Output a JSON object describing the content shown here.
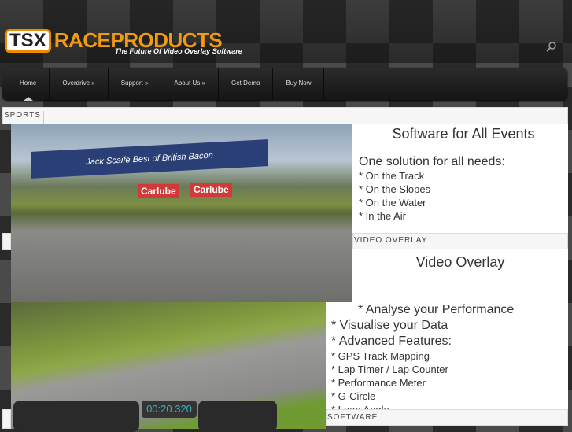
{
  "header": {
    "logo_tsx": "TSX",
    "logo_name": "RACEPRODUCTS",
    "tagline": "The Future Of Video Overlay Software"
  },
  "nav": [
    "Home",
    "Overdrive »",
    "Support »",
    "About Us »",
    "Get Demo",
    "Buy Now"
  ],
  "sections": {
    "sports": "SPORTS",
    "video_overlay": "VIDEO OVERLAY",
    "software": "SOFTWARE"
  },
  "panel1": {
    "title": "Software for All Events",
    "subtitle": "One solution for all needs:",
    "items": [
      "* On the Track",
      "* On the Slopes",
      "* On the Water",
      "* In the Air"
    ]
  },
  "panel2": {
    "title": "Video Overlay",
    "main_items": [
      "* Analyse your Performance",
      "* Visualise your Data",
      "* Advanced Features:"
    ],
    "items": [
      "* GPS Track Mapping",
      "* Lap Timer / Lap Counter",
      "* Performance Meter",
      "* G-Circle",
      "* Lean Angle"
    ]
  },
  "photo1": {
    "banner": "Jack Scaife Best of British Bacon",
    "sign1": "Carlube",
    "sign2": "Carlube"
  },
  "photo2": {
    "timer": "00:20.320"
  }
}
